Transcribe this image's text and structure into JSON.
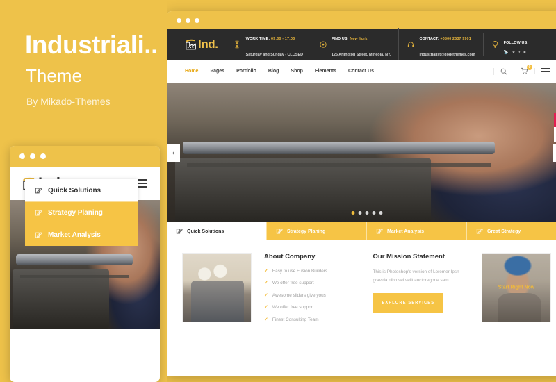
{
  "promo": {
    "title": "Industriali..",
    "subtitle": "Theme",
    "author": "By Mikado-Themes"
  },
  "colors": {
    "brand_yellow": "#eec24a",
    "tab_yellow": "#f6c445",
    "dark_bar": "#2b2b2b",
    "accent_red": "#e31e52",
    "check_yellow": "#f3b92e"
  },
  "mobile": {
    "logo_text": "Ind.",
    "menu_icon": "hamburger-icon",
    "tabs": [
      {
        "label": "Quick Solutions",
        "icon": "edit-square-icon",
        "active": true
      },
      {
        "label": "Strategy Planing",
        "icon": "edit-square-icon",
        "active": false
      },
      {
        "label": "Market Analysis",
        "icon": "edit-square-icon",
        "active": false
      }
    ]
  },
  "browser": {
    "logo_text": "Ind.",
    "topbar": [
      {
        "icon": "hourglass-icon",
        "label": "WORK TIME:",
        "value": "09:00 - 17:00",
        "line2": "Saturday and Sunday - CLOSED"
      },
      {
        "icon": "map-pin-icon",
        "label": "FIND US:",
        "value": "New York",
        "line2": "126 Arlington Street, Mineola, NY,"
      },
      {
        "icon": "headset-icon",
        "label": "CONTACT:",
        "value": "+0800 2537 9901",
        "line2": "industrialist@qodethemes.com"
      }
    ],
    "follow": {
      "icon": "bulb-icon",
      "label": "FOLLOW US:",
      "socials": [
        "rss-icon",
        "twitter-icon",
        "facebook-icon",
        "instagram-icon"
      ]
    },
    "nav": {
      "items": [
        {
          "label": "Home",
          "active": true
        },
        {
          "label": "Pages",
          "active": false
        },
        {
          "label": "Portfolio",
          "active": false
        },
        {
          "label": "Blog",
          "active": false
        },
        {
          "label": "Shop",
          "active": false
        },
        {
          "label": "Elements",
          "active": false
        },
        {
          "label": "Contact Us",
          "active": false
        }
      ],
      "tools": {
        "search_icon": "search-icon",
        "cart_icon": "cart-icon",
        "cart_count": "0",
        "menu_icon": "hamburger-icon"
      }
    },
    "hero": {
      "prev_icon": "chevron-left-icon",
      "next_icon": "chevron-right-icon",
      "slide_count": 5,
      "active_slide": 1,
      "side_buttons": [
        {
          "icon": "gem-icon",
          "style": "red"
        },
        {
          "icon": "cart-icon",
          "style": "white"
        }
      ]
    },
    "tabs": [
      {
        "label": "Quick Solutions",
        "icon": "edit-square-icon",
        "active": true
      },
      {
        "label": "Strategy Planing",
        "icon": "edit-square-icon",
        "active": false
      },
      {
        "label": "Market Analysis",
        "icon": "edit-square-icon",
        "active": false
      },
      {
        "label": "Great Strategy",
        "icon": "edit-square-icon",
        "active": false
      }
    ],
    "content": {
      "about": {
        "heading": "About Company",
        "items": [
          "Easy to use Fusion Builders",
          "We offer free support",
          "Awesome sliders give yous",
          "We offer free support",
          "Finest Consulting Team"
        ]
      },
      "mission": {
        "heading": "Our Mission Statement",
        "paragraph": "This is Photoshop's version of Loremer Ipsn gravida nibh vel velit auctoregorie sam",
        "button": "EXPLORE SERVICES"
      },
      "card": {
        "label": "Start Right Now"
      }
    }
  }
}
